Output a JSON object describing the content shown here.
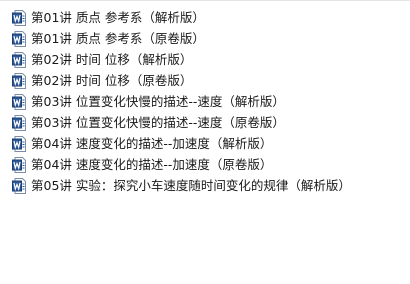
{
  "files": [
    {
      "name": "第01讲 质点  参考系（解析版）",
      "icon": "word-doc-icon"
    },
    {
      "name": "第01讲 质点  参考系（原卷版）",
      "icon": "word-doc-icon"
    },
    {
      "name": "第02讲 时间  位移（解析版）",
      "icon": "word-doc-icon"
    },
    {
      "name": "第02讲 时间  位移（原卷版）",
      "icon": "word-doc-icon"
    },
    {
      "name": "第03讲 位置变化快慢的描述--速度（解析版）",
      "icon": "word-doc-icon"
    },
    {
      "name": "第03讲 位置变化快慢的描述--速度（原卷版）",
      "icon": "word-doc-icon"
    },
    {
      "name": "第04讲 速度变化的描述--加速度（解析版）",
      "icon": "word-doc-icon"
    },
    {
      "name": "第04讲 速度变化的描述--加速度（原卷版）",
      "icon": "word-doc-icon"
    },
    {
      "name": "第05讲 实验：探究小车速度随时间变化的规律（解析版）",
      "icon": "word-doc-icon"
    }
  ],
  "colors": {
    "icon_blue": "#2b5797",
    "icon_border": "#1e3f73",
    "text": "#1a1a1a",
    "background": "#ffffff"
  }
}
